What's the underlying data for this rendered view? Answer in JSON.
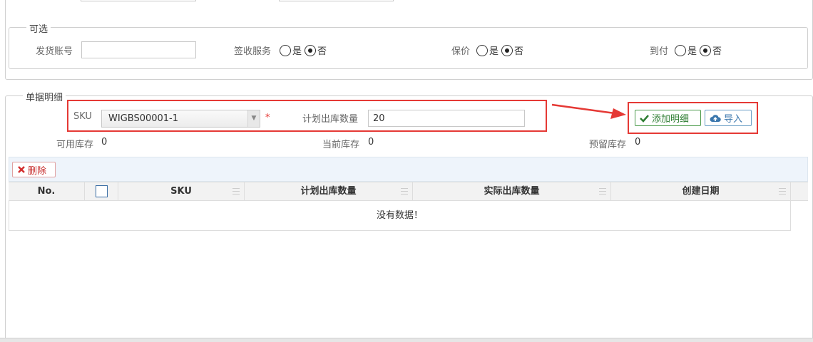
{
  "optional": {
    "legend": "可选",
    "account_label": "发货账号",
    "account_value": "",
    "sign_service_label": "签收服务",
    "insure_label": "保价",
    "cod_label": "到付",
    "yes": "是",
    "no": "否"
  },
  "detail": {
    "legend": "单据明细",
    "sku_label": "SKU",
    "sku_value": "WIGBS00001-1",
    "required_mark": "*",
    "qty_label": "计划出库数量",
    "qty_value": "20",
    "add_button": "添加明细",
    "import_button": "导入",
    "available_label": "可用库存",
    "available_value": "0",
    "current_label": "当前库存",
    "current_value": "0",
    "reserved_label": "预留库存",
    "reserved_value": "0"
  },
  "toolbar": {
    "delete_button": "删除"
  },
  "table": {
    "columns": [
      "No.",
      "SKU",
      "计划出库数量",
      "实际出库数量",
      "创建日期"
    ],
    "empty_text": "没有数据！"
  },
  "colors": {
    "annotation": "#e53935",
    "success": "#2e7d32",
    "primary": "#3b77ad",
    "danger": "#c62828"
  },
  "icons": [
    "check-icon",
    "cloud-upload-icon",
    "close-icon",
    "chevron-down-icon",
    "arrow-icon"
  ]
}
